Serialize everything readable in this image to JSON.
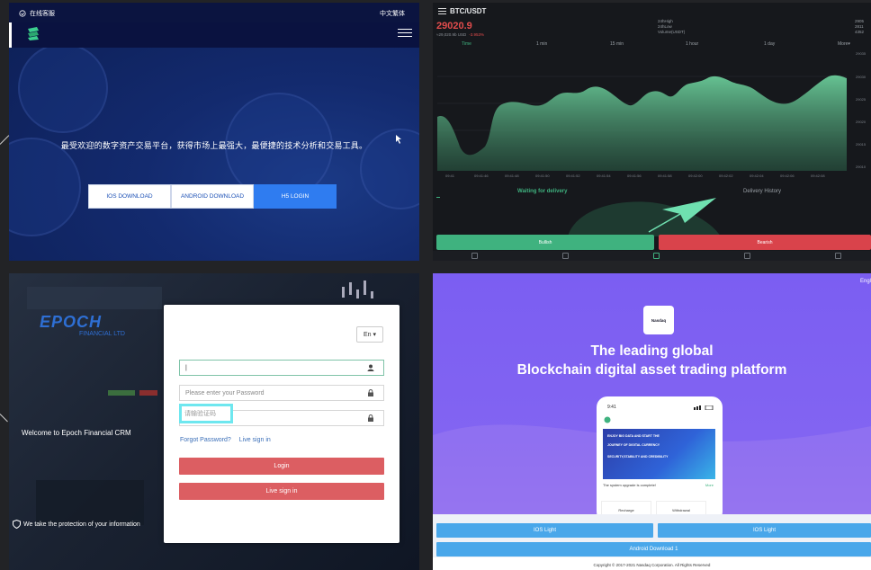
{
  "panel1": {
    "service_label": "在线客服",
    "language": "中文繁体",
    "slogan": "最受欢迎的数字资产交易平台，获得市场上最强大，最便捷的技术分析和交易工具。",
    "buttons": [
      "IOS DOWNLOAD",
      "ANDROID DOWNLOAD",
      "H5 LOGIN"
    ]
  },
  "panel2": {
    "pair": "BTC/USDT",
    "price": "29020.9",
    "sub_price": "≈29,020.9b USD",
    "change": "-3.953%",
    "stats": [
      "24hHigh",
      "24hLow",
      "Volume(USDT)"
    ],
    "stats_right": [
      "2905",
      "2811",
      "4352"
    ],
    "tabs": [
      "Time",
      "1 min",
      "15 min",
      "1 hour",
      "1 day",
      "More▾"
    ],
    "x_ticks": [
      "09:41",
      "09:41:46",
      "09:41:48",
      "09:41:50",
      "09:41:52",
      "09:41:54",
      "09:41:56",
      "09:41:58",
      "09:42:00",
      "09:42:02",
      "09:42:04",
      "09:42:06",
      "09:42:08"
    ],
    "y_ticks": [
      "29035",
      "29030",
      "29025",
      "29020",
      "29015",
      "29010",
      "29005"
    ],
    "order_tabs": [
      "Waiting for delivery",
      "Delivery History"
    ],
    "bullish": "Bullish",
    "bearish": "Bearish"
  },
  "panel3": {
    "brand": "EPOCH",
    "brand_sub": "FINANCIAL LTD",
    "welcome": "Welcome to Epoch Financial CRM",
    "protection": "We take the protection of your information",
    "language": "En ▾",
    "password_placeholder": "Please enter your Password",
    "captcha_placeholder": "请输验证码",
    "forgot": "Forgot Password?",
    "live_sign_in_link": "Live sign in",
    "login": "Login",
    "live_sign_in": "Live sign in"
  },
  "panel4": {
    "lang": "Engl",
    "logo": "Nasdaq",
    "headline1": "The leading global",
    "headline2": "Blockchain digital asset trading platform",
    "phone_time": "9:41",
    "banner_lines": [
      "ENJOY BIG DATA AND START THE",
      "JOURNEY OF DIGITAL CURRENCY",
      "SECURITY,STABILITY AND CREDIBILITY"
    ],
    "notice": "The system upgrade is complete!",
    "notice_more": "More",
    "tiles": [
      "Recharge",
      "Withdrawal"
    ],
    "ios_left": "IOS Light",
    "ios_right": "IOS Light",
    "android": "Android Download 1",
    "footer": "Copyright © 2017-2021 Nasdaq Corporation. All Rights Reserved"
  },
  "colors": {
    "p1_button": "#2f7cf0",
    "p2_bull": "#3fb27f",
    "p2_bear": "#d9434b",
    "p3_button": "#dc5e62",
    "p4_button": "#49a7ea"
  }
}
